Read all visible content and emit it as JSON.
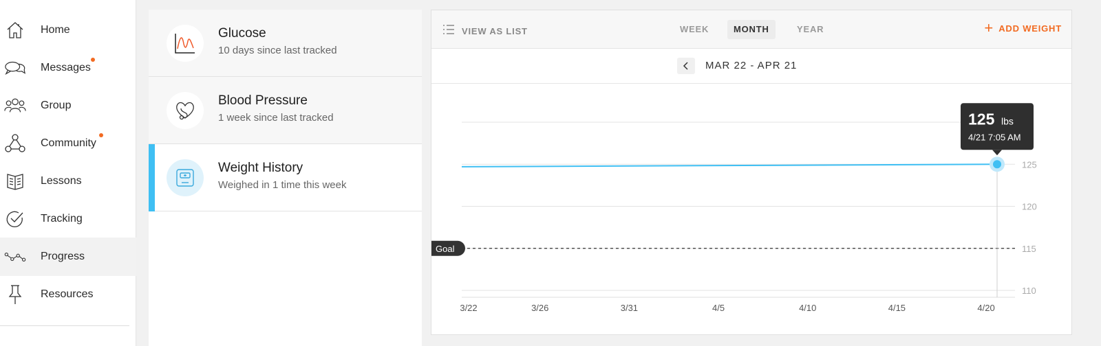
{
  "sidebar": {
    "items": [
      {
        "label": "Home",
        "icon": "home-icon",
        "notification": false,
        "active": false
      },
      {
        "label": "Messages",
        "icon": "chat-bubbles-icon",
        "notification": true,
        "active": false
      },
      {
        "label": "Group",
        "icon": "group-icon",
        "notification": false,
        "active": false
      },
      {
        "label": "Community",
        "icon": "community-network-icon",
        "notification": true,
        "active": false
      },
      {
        "label": "Lessons",
        "icon": "book-icon",
        "notification": false,
        "active": false
      },
      {
        "label": "Tracking",
        "icon": "checkmark-circle-icon",
        "notification": false,
        "active": false
      },
      {
        "label": "Progress",
        "icon": "progress-line-icon",
        "notification": false,
        "active": true
      },
      {
        "label": "Resources",
        "icon": "pushpin-icon",
        "notification": false,
        "active": false
      }
    ],
    "notification_color": "#f26b22"
  },
  "trackers": [
    {
      "title": "Glucose",
      "subtitle": "10 days since last tracked",
      "icon": "glucose-chart-icon",
      "active": false
    },
    {
      "title": "Blood Pressure",
      "subtitle": "1 week since last tracked",
      "icon": "heart-stethoscope-icon",
      "active": false
    },
    {
      "title": "Weight History",
      "subtitle": "Weighed in 1 time this week",
      "icon": "scale-icon",
      "active": true
    }
  ],
  "toolbar": {
    "view_as_list": "VIEW AS LIST",
    "tabs": [
      {
        "label": "WEEK",
        "active": false
      },
      {
        "label": "MONTH",
        "active": true
      },
      {
        "label": "YEAR",
        "active": false
      }
    ],
    "add_weight": "ADD WEIGHT",
    "accent_color": "#f26b22"
  },
  "date_nav": {
    "range": "MAR 22 - APR 21"
  },
  "chart_data": {
    "type": "line",
    "x_tick_labels": [
      "3/22",
      "3/26",
      "3/31",
      "4/5",
      "4/10",
      "4/15",
      "4/20"
    ],
    "x_tick_days": [
      0,
      4,
      9,
      14,
      19,
      24,
      29
    ],
    "x_range_days": [
      0,
      30
    ],
    "y_ticks": [
      110,
      115,
      120,
      125
    ],
    "ylim": [
      110,
      130
    ],
    "series": [
      {
        "name": "",
        "color": "#3fbff3",
        "points": [
          {
            "day": 0,
            "value": 124.7
          },
          {
            "day": 30,
            "value": 125
          }
        ]
      }
    ],
    "goal": {
      "label": "Goal",
      "value": 115
    },
    "tooltip": {
      "value": "125",
      "unit": "lbs",
      "datetime": "4/21 7:05 AM",
      "day": 30,
      "point_value": 125
    },
    "grid": true
  }
}
